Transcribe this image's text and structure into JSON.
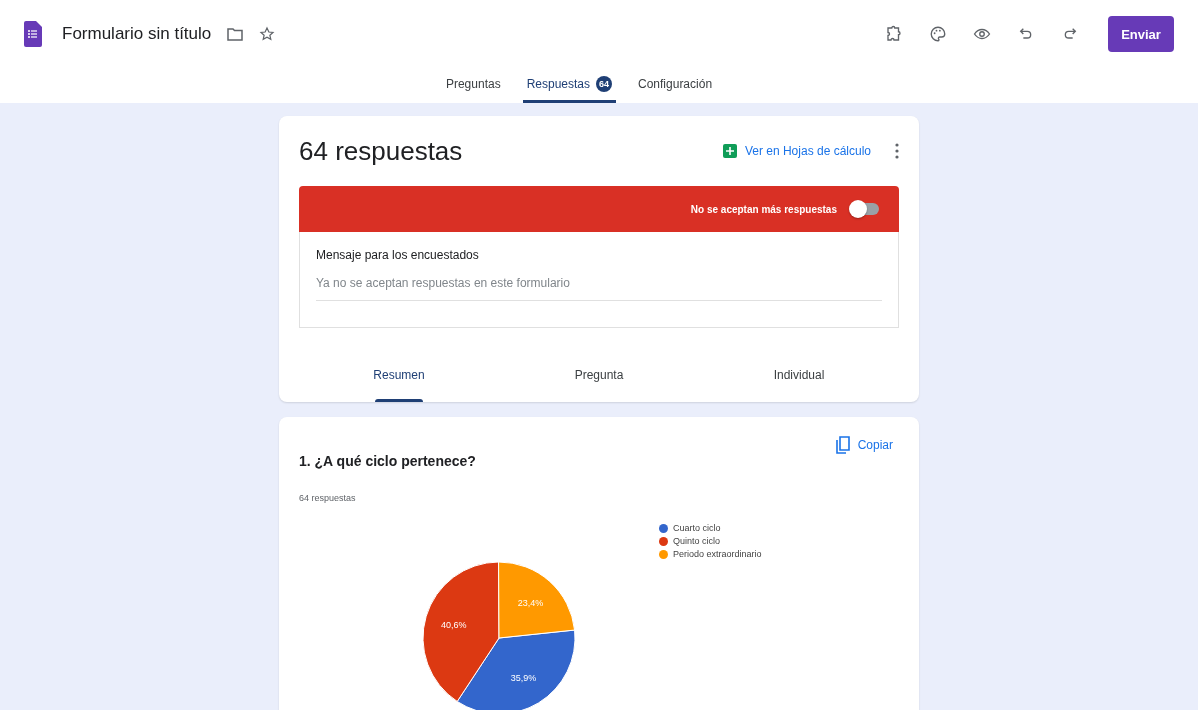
{
  "header": {
    "title": "Formulario sin título",
    "send_button": "Enviar"
  },
  "tabs": [
    {
      "label": "Preguntas",
      "selected": false
    },
    {
      "label": "Respuestas",
      "selected": true,
      "badge": "64"
    },
    {
      "label": "Configuración",
      "selected": false
    }
  ],
  "summary_card": {
    "title": "64 respuestas",
    "sheets_link": "Ver en Hojas de cálculo",
    "banner": {
      "label": "No se aceptan más respuestas",
      "on": false
    },
    "message": {
      "label": "Mensaje para los encuestados",
      "value": "Ya no se aceptan respuestas en este formulario"
    },
    "view_tabs": [
      {
        "label": "Resumen",
        "selected": true
      },
      {
        "label": "Pregunta",
        "selected": false
      },
      {
        "label": "Individual",
        "selected": false
      }
    ]
  },
  "question_card": {
    "title": "1. ¿A qué ciclo pertenece?",
    "copy_button": "Copiar",
    "count": "64 respuestas",
    "chart_data": {
      "type": "pie",
      "legend": "right",
      "categories": [
        "Cuarto ciclo",
        "Quinto ciclo",
        "Periodo extraordinario"
      ],
      "values": [
        35.9,
        40.6,
        23.4
      ],
      "value_labels": [
        "35,9%",
        "40,6%",
        "23,4%"
      ],
      "colors": [
        "#3366cc",
        "#dc3912",
        "#ff9900"
      ]
    }
  }
}
